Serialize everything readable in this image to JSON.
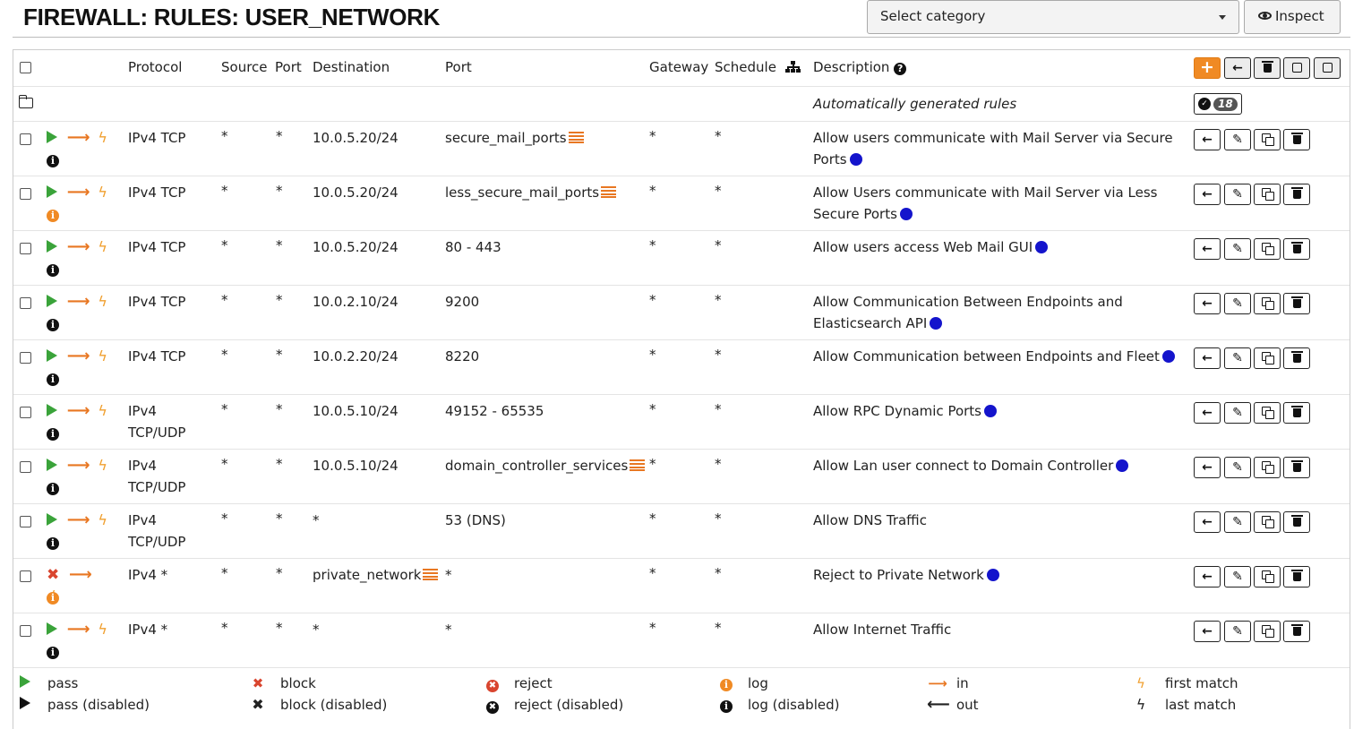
{
  "header": {
    "title": "FIREWALL: RULES: USER_NETWORK",
    "category_select": "Select category",
    "inspect_label": "Inspect"
  },
  "columns": {
    "protocol": "Protocol",
    "source": "Source",
    "source_port": "Port",
    "destination": "Destination",
    "dest_port": "Port",
    "gateway": "Gateway",
    "schedule": "Schedule",
    "description": "Description"
  },
  "auto_rules": {
    "label": "Automatically generated rules",
    "count": "18"
  },
  "rules": [
    {
      "action": "pass",
      "log": "info",
      "protocol": "IPv4 TCP",
      "source": "*",
      "source_port": "*",
      "destination": "10.0.5.20/24",
      "port": "secure_mail_ports",
      "port_alias": true,
      "dest_alias": false,
      "gateway": "*",
      "schedule": "*",
      "description": "Allow users communicate with Mail Server via Secure Ports"
    },
    {
      "action": "pass",
      "log": "log",
      "protocol": "IPv4 TCP",
      "source": "*",
      "source_port": "*",
      "destination": "10.0.5.20/24",
      "port": "less_secure_mail_ports",
      "port_alias": true,
      "dest_alias": false,
      "gateway": "*",
      "schedule": "*",
      "description": "Allow Users communicate with Mail Server via Less Secure Ports"
    },
    {
      "action": "pass",
      "log": "info",
      "protocol": "IPv4 TCP",
      "source": "*",
      "source_port": "*",
      "destination": "10.0.5.20/24",
      "port": "80 - 443",
      "port_alias": false,
      "dest_alias": false,
      "gateway": "*",
      "schedule": "*",
      "description": "Allow users access Web Mail GUI"
    },
    {
      "action": "pass",
      "log": "info",
      "protocol": "IPv4 TCP",
      "source": "*",
      "source_port": "*",
      "destination": "10.0.2.10/24",
      "port": "9200",
      "port_alias": false,
      "dest_alias": false,
      "gateway": "*",
      "schedule": "*",
      "description": "Allow Communication Between Endpoints and Elasticsearch API"
    },
    {
      "action": "pass",
      "log": "info",
      "protocol": "IPv4 TCP",
      "source": "*",
      "source_port": "*",
      "destination": "10.0.2.20/24",
      "port": "8220",
      "port_alias": false,
      "dest_alias": false,
      "gateway": "*",
      "schedule": "*",
      "description": "Allow Communication between Endpoints and Fleet"
    },
    {
      "action": "pass",
      "log": "info",
      "protocol": "IPv4 TCP/UDP",
      "source": "*",
      "source_port": "*",
      "destination": "10.0.5.10/24",
      "port": "49152 - 65535",
      "port_alias": false,
      "dest_alias": false,
      "gateway": "*",
      "schedule": "*",
      "description": "Allow RPC Dynamic Ports"
    },
    {
      "action": "pass",
      "log": "info",
      "protocol": "IPv4 TCP/UDP",
      "source": "*",
      "source_port": "*",
      "destination": "10.0.5.10/24",
      "port": "domain_controller_services",
      "port_alias": true,
      "dest_alias": false,
      "gateway": "*",
      "schedule": "*",
      "description": "Allow Lan user connect to Domain Controller"
    },
    {
      "action": "pass",
      "log": "info",
      "protocol": "IPv4 TCP/UDP",
      "source": "*",
      "source_port": "*",
      "destination": "*",
      "port": "53 (DNS)",
      "port_alias": false,
      "dest_alias": false,
      "gateway": "*",
      "schedule": "*",
      "description": "Allow DNS Traffic"
    },
    {
      "action": "block",
      "log": "log",
      "protocol": "IPv4 *",
      "source": "*",
      "source_port": "*",
      "destination": "private_network",
      "port": "*",
      "port_alias": false,
      "dest_alias": true,
      "gateway": "*",
      "schedule": "*",
      "description": "Reject to Private Network"
    },
    {
      "action": "pass",
      "log": "info",
      "protocol": "IPv4 *",
      "source": "*",
      "source_port": "*",
      "destination": "*",
      "port": "*",
      "port_alias": false,
      "dest_alias": false,
      "gateway": "*",
      "schedule": "*",
      "description": "Allow Internet Traffic"
    }
  ],
  "legend": {
    "pass": "pass",
    "pass_disabled": "pass (disabled)",
    "block": "block",
    "block_disabled": "block (disabled)",
    "reject": "reject",
    "reject_disabled": "reject (disabled)",
    "log": "log",
    "log_disabled": "log (disabled)",
    "in": "in",
    "out": "out",
    "first_match": "first match",
    "last_match": "last match"
  },
  "colors": {
    "accent": "#f08a24",
    "pass": "#3aa33a",
    "block": "#d9452f",
    "category_dot": "#1414cc"
  }
}
